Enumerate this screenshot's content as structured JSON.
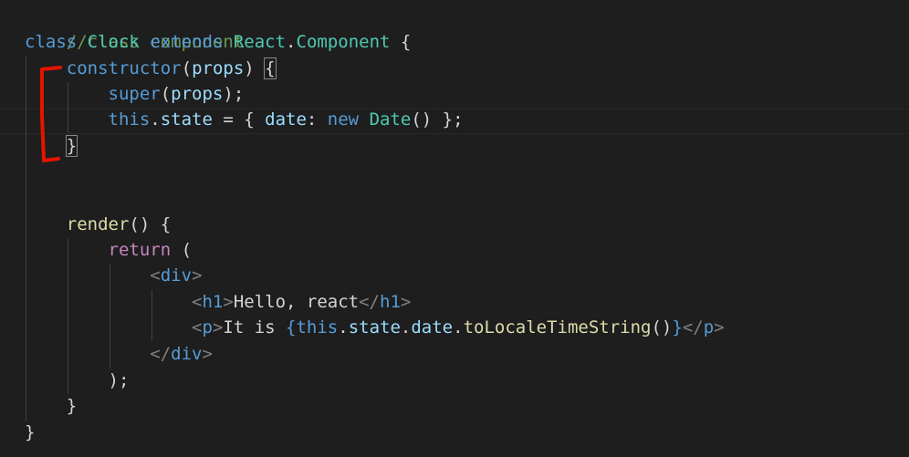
{
  "editor": {
    "language": "javascript-jsx",
    "theme": "dark",
    "lines": {
      "l1": "//class component",
      "l2_kw": "class",
      "l2_name": "Clock",
      "l2_ext": "extends",
      "l2_react": "React",
      "l2_comp": "Component",
      "l3_ctor": "constructor",
      "l3_props": "props",
      "l4_super": "super",
      "l4_props": "props",
      "l5_this": "this",
      "l5_state": "state",
      "l5_date": "date",
      "l5_new": "new",
      "l5_Date": "Date",
      "l9_render": "render",
      "l10_return": "return",
      "l11_div": "div",
      "l12_h1": "h1",
      "l12_text": "Hello, react",
      "l13_p": "p",
      "l13_text": "It is ",
      "l13_this": "this",
      "l13_state": "state",
      "l13_date": "date",
      "l13_fn": "toLocaleTimeString",
      "l14_div": "div"
    },
    "colors": {
      "background": "#1e1e1e",
      "annotation_red": "#e51400"
    }
  }
}
